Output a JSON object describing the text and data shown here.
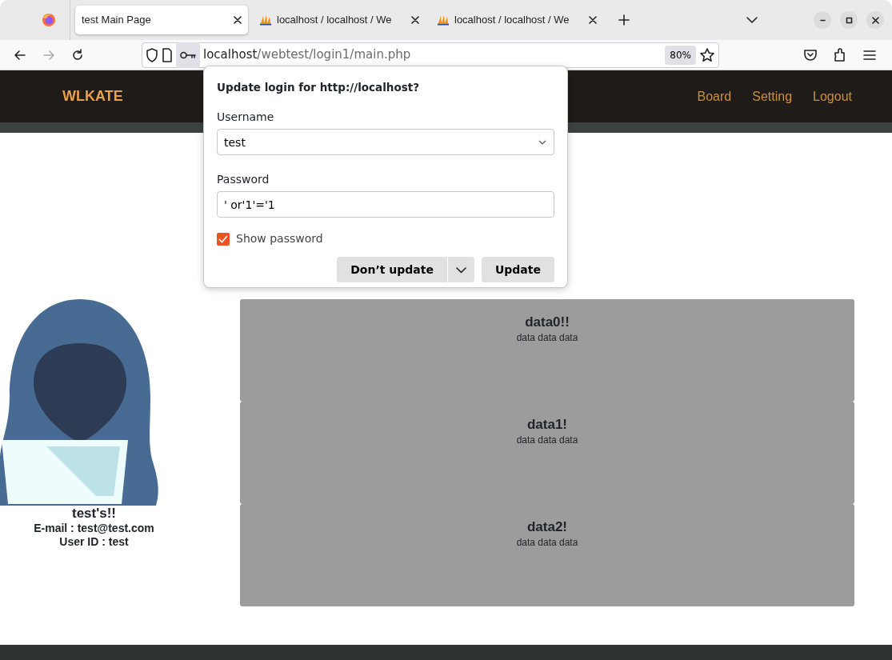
{
  "browser": {
    "tabs": [
      {
        "label": "test Main Page",
        "kind": "page",
        "selected": true
      },
      {
        "label": "localhost / localhost / We",
        "kind": "pma",
        "selected": false
      },
      {
        "label": "localhost / localhost / We",
        "kind": "pma",
        "selected": false
      }
    ],
    "nav_buttons": [
      {
        "kind": "back",
        "disabled": false
      },
      {
        "kind": "forward",
        "disabled": true
      },
      {
        "kind": "reload",
        "disabled": false
      }
    ],
    "url": {
      "host": "localhost",
      "path": "/webtest/login1/main.php"
    },
    "zoom": "80%"
  },
  "site": {
    "brand": "WLKATE",
    "nav": [
      "Board",
      "Setting",
      "Logout"
    ],
    "profile": {
      "name": "test's!!",
      "email": "E-mail : test@test.com",
      "user_id": "User ID : test"
    },
    "cards": [
      {
        "title": "data0!!",
        "text": "data data data"
      },
      {
        "title": "data1!",
        "text": "data data data"
      },
      {
        "title": "data2!",
        "text": "data data data"
      }
    ]
  },
  "login_popup": {
    "title": "Update login for http://localhost?",
    "username": {
      "label": "Username",
      "value": "test"
    },
    "password": {
      "label": "Password",
      "value": "' or'1'='1"
    },
    "show_password": {
      "label": "Show password",
      "checked": true
    },
    "buttons": {
      "secondary": "Don’t update",
      "primary": "Update"
    }
  }
}
